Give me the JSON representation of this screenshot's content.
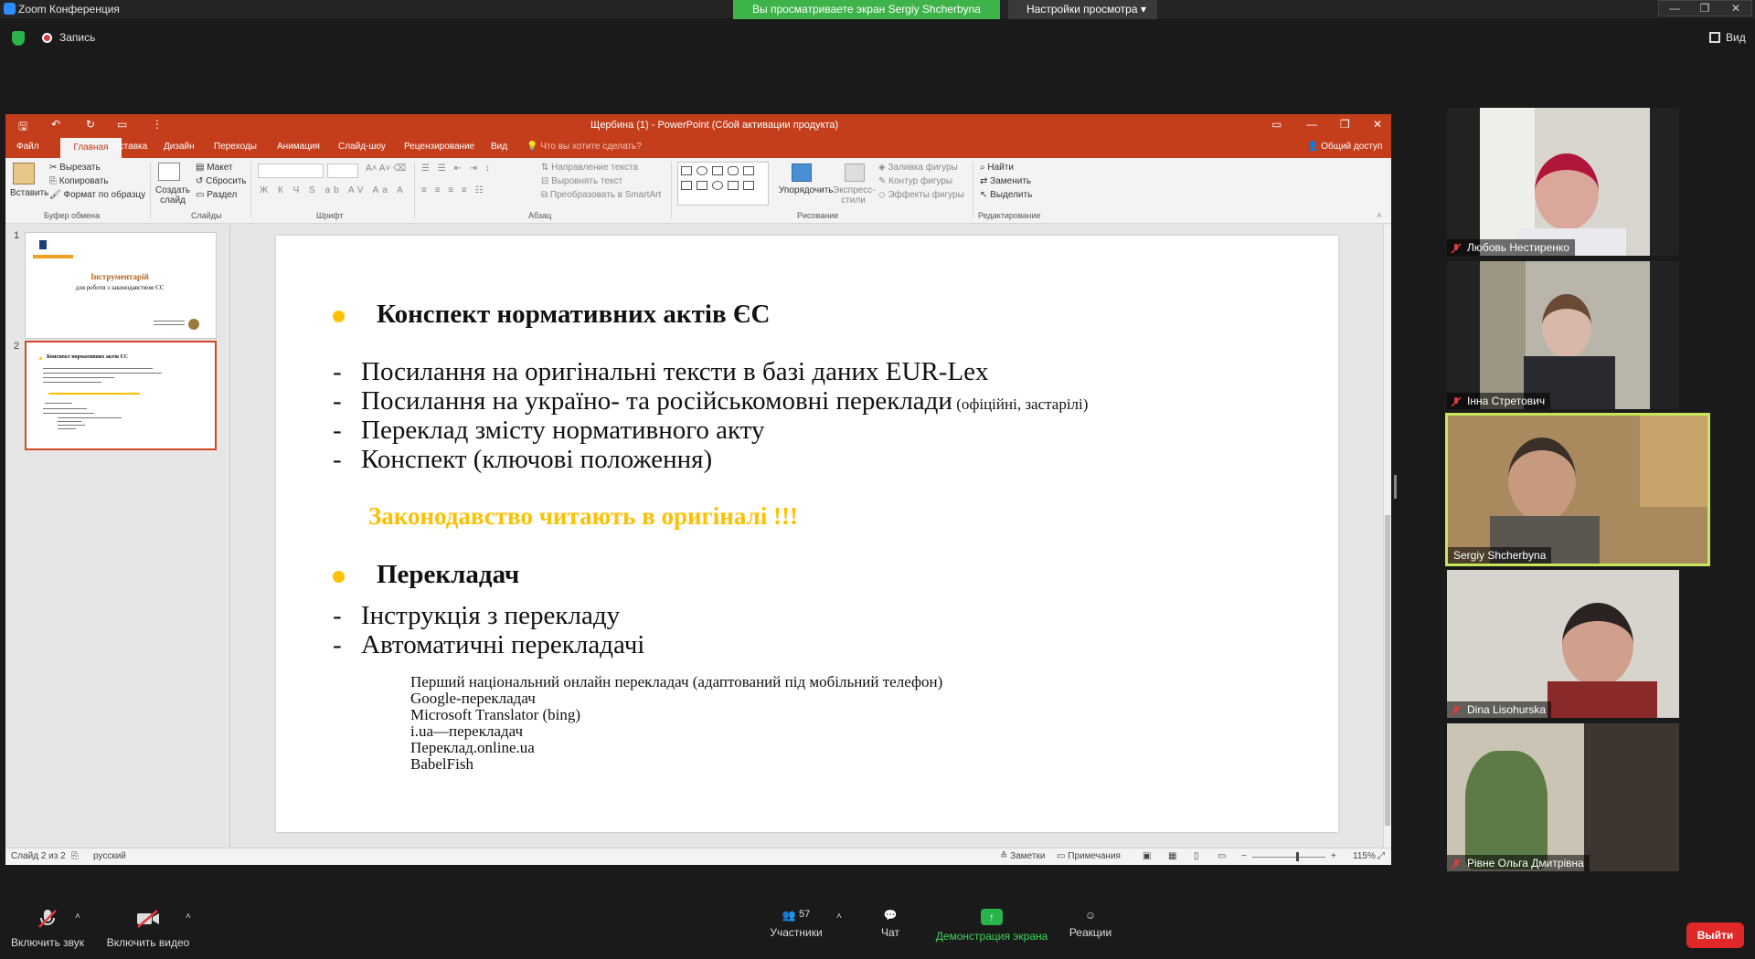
{
  "zoom": {
    "window_title": "Zoom Конференция",
    "share_banner": "Вы просматриваете экран Sergiy Shcherbyna",
    "view_settings": "Настройки просмотра",
    "recording_label": "Запись",
    "view_label": "Вид"
  },
  "ppt": {
    "window_title": "Щербина (1) - PowerPoint (Сбой активации продукта)",
    "tabs": [
      "Файл",
      "Главная",
      "Вставка",
      "Дизайн",
      "Переходы",
      "Анимация",
      "Слайд-шоу",
      "Рецензирование",
      "Вид"
    ],
    "tell_me": "Что вы хотите сделать?",
    "share": "Общий доступ",
    "ribbon": {
      "paste": "Вставить",
      "cut": "Вырезать",
      "copy": "Копировать",
      "format_painter": "Формат по образцу",
      "clipboard_group": "Буфер обмена",
      "new_slide": "Создать слайд",
      "layout": "Макет",
      "reset": "Сбросить",
      "section": "Раздел",
      "slides_group": "Слайды",
      "font_group": "Шрифт",
      "text_direction": "Направление текста",
      "align_text": "Выровнять текст",
      "smartart": "Преобразовать в SmartArt",
      "paragraph_group": "Абзац",
      "arrange": "Упорядочить",
      "quick_styles": "Экспресс-стили",
      "shape_fill": "Заливка фигуры",
      "shape_outline": "Контур фигуры",
      "shape_effects": "Эффекты фигуры",
      "drawing_group": "Рисование",
      "find": "Найти",
      "replace": "Заменить",
      "select": "Выделить",
      "editing_group": "Редактирование"
    },
    "thumbs": [
      {
        "num": "1",
        "title": "Інструментарій",
        "subtitle": "для роботи з законодавством ЄС"
      },
      {
        "num": "2",
        "title": "Конспект нормативних актів ЄС"
      }
    ],
    "slide": {
      "heading1": "Конспект нормативних актів ЄС",
      "items1": [
        {
          "dash": "-",
          "text": "Посилання на оригінальні тексти в базі даних EUR-Lex",
          "note": ""
        },
        {
          "dash": "-",
          "text": "Посилання на україно- та російськомовні переклади",
          "note": " (офіційні, застарілі)"
        },
        {
          "dash": "-",
          "text": "Переклад змісту нормативного акту",
          "note": ""
        },
        {
          "dash": "-",
          "text": "Конспект (ключові положення)",
          "note": ""
        }
      ],
      "accent": "Законодавство читають в оригіналі !!!",
      "heading2": "Перекладач",
      "items2": [
        {
          "dash": "-",
          "text": "Інструкція з перекладу"
        },
        {
          "dash": "-",
          "text": "Автоматичні перекладачі"
        }
      ],
      "translators": [
        "Перший національний онлайн перекладач (адаптований під мобільний телефон)",
        "Google-перекладач",
        "Microsoft Translator (bing)",
        "i.ua—перекладач",
        "Переклад.online.ua",
        "BabelFish"
      ]
    },
    "status": {
      "slide_counter": "Слайд 2 из 2",
      "language": "русский",
      "notes": "Заметки",
      "comments": "Примечания",
      "zoom": "115%"
    }
  },
  "participants": [
    {
      "name": "Любовь Нестиренко",
      "muted": true
    },
    {
      "name": "Інна Стретович",
      "muted": true
    },
    {
      "name": "Sergiy Shcherbyna",
      "muted": false,
      "active": true
    },
    {
      "name": "Dina Lisohurska",
      "muted": true
    },
    {
      "name": "Рівне Ольга Дмитрівна",
      "muted": true
    }
  ],
  "toolbar": {
    "unmute": "Включить звук",
    "start_video": "Включить видео",
    "participants": "Участники",
    "participants_count": "57",
    "chat": "Чат",
    "share_screen": "Демонстрация экрана",
    "reactions": "Реакции",
    "leave": "Выйти"
  },
  "colors": {
    "ppt_accent": "#c43e1c",
    "share_green": "#3eb34a",
    "bullet_yellow": "#ffc000",
    "leave_red": "#e02828",
    "active_speaker": "#c8e65a"
  }
}
